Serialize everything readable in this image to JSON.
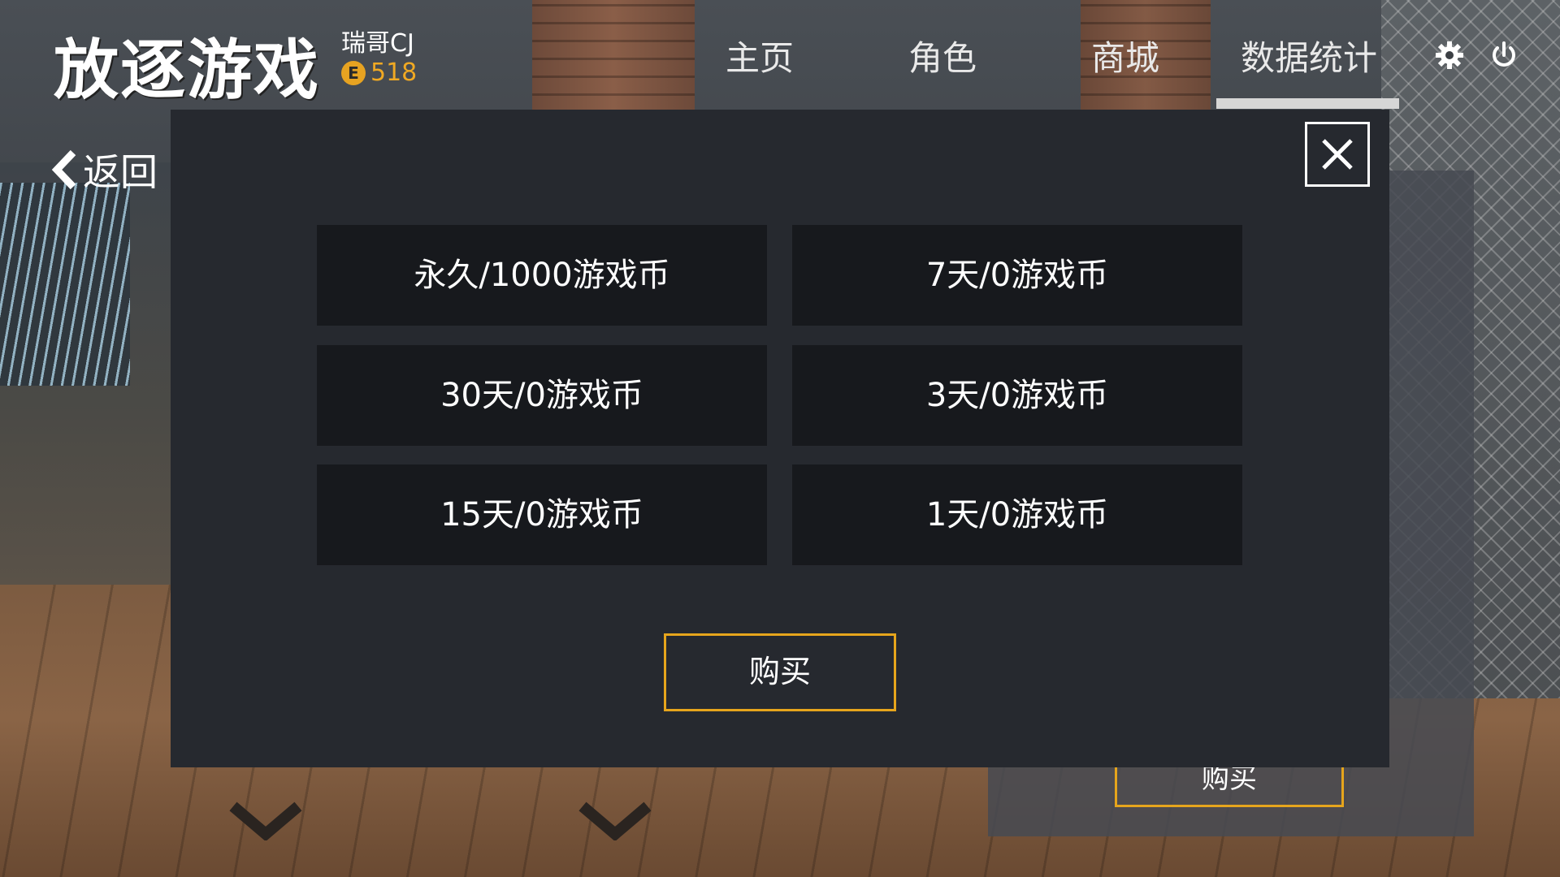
{
  "header": {
    "logo": "放逐游戏",
    "user_name": "瑞哥CJ",
    "coin_icon_glyph": "E",
    "coin_value": "518",
    "tabs": [
      {
        "label": "主页"
      },
      {
        "label": "角色"
      },
      {
        "label": "商城"
      },
      {
        "label": "数据统计",
        "active": true
      }
    ],
    "icons": [
      "gear-icon",
      "power-icon"
    ]
  },
  "back": {
    "label": "返回",
    "icon": "chevron-left-icon"
  },
  "dialog": {
    "close_icon": "close-icon",
    "options": [
      {
        "label": "永久/1000游戏币"
      },
      {
        "label": "7天/0游戏币"
      },
      {
        "label": "30天/0游戏币"
      },
      {
        "label": "3天/0游戏币"
      },
      {
        "label": "15天/0游戏币"
      },
      {
        "label": "1天/0游戏币"
      }
    ],
    "buy_label": "购买"
  },
  "background": {
    "behind_buy_label": "购买"
  },
  "colors": {
    "accent": "#e6a51c",
    "dialog_bg": "#26292f",
    "option_bg": "#17191d",
    "coin": "#f0a923"
  }
}
